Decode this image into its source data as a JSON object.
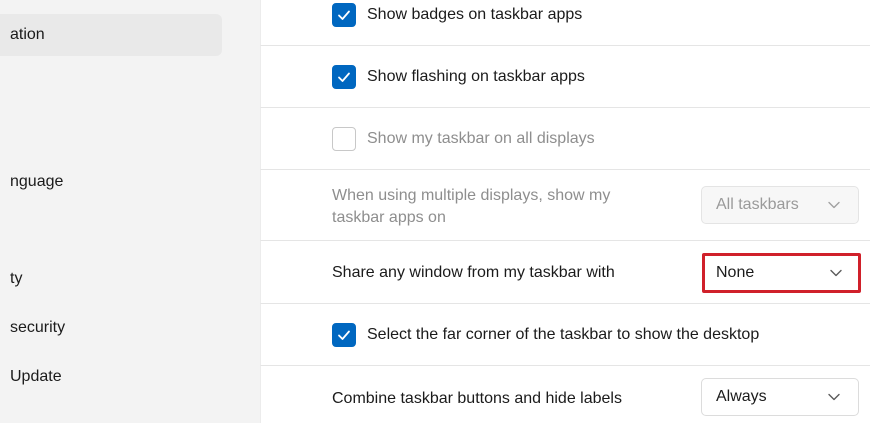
{
  "sidebar": {
    "items": [
      {
        "label": "ation",
        "selected": true
      },
      {
        "label": "nguage",
        "selected": false
      },
      {
        "label": "ty",
        "selected": false
      },
      {
        "label": "security",
        "selected": false
      },
      {
        "label": "Update",
        "selected": false
      }
    ]
  },
  "settings": {
    "show_badges": {
      "label": "Show badges on taskbar apps",
      "checked": true
    },
    "show_flashing": {
      "label": "Show flashing on taskbar apps",
      "checked": true
    },
    "show_all_displays": {
      "label": "Show my taskbar on all displays",
      "checked": false,
      "disabled": true
    },
    "multiple_displays": {
      "label_line1": "When using multiple displays, show my",
      "label_line2": "taskbar apps on",
      "value": "All taskbars",
      "disabled": true
    },
    "share_window": {
      "label": "Share any window from my taskbar with",
      "value": "None"
    },
    "far_corner": {
      "label": "Select the far corner of the taskbar to show the desktop",
      "checked": true
    },
    "combine_buttons": {
      "label": "Combine taskbar buttons and hide labels",
      "value": "Always"
    }
  },
  "colors": {
    "accent": "#0067c0",
    "highlight": "#d0202a"
  }
}
